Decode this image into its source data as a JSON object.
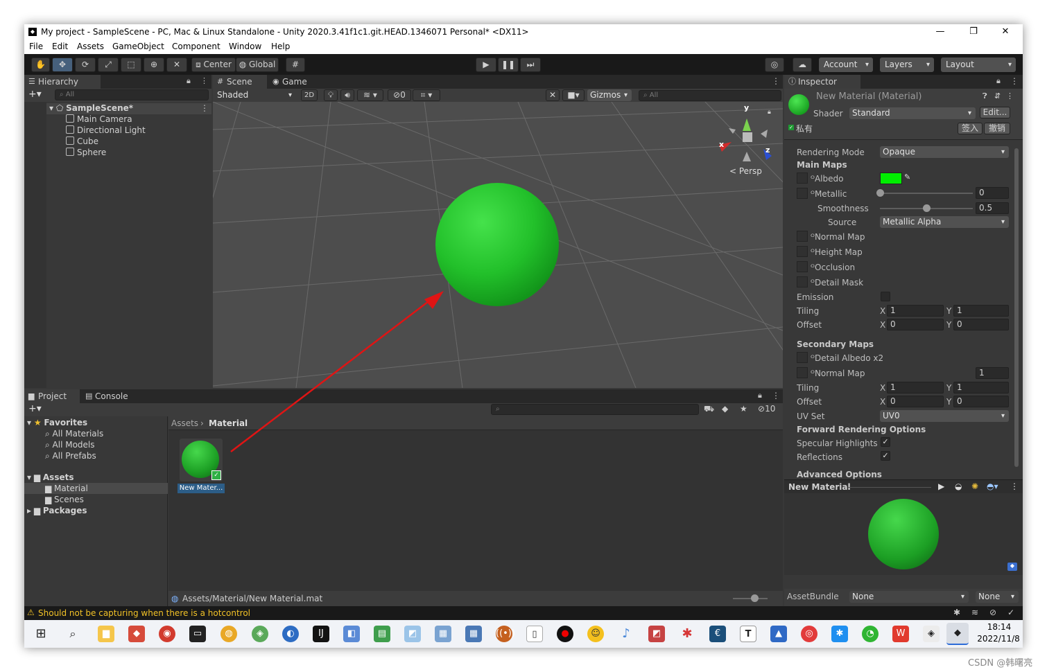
{
  "window": {
    "title": "My project - SampleScene - PC, Mac & Linux Standalone - Unity 2020.3.41f1c1.git.HEAD.1346071 Personal* <DX11>",
    "min": "—",
    "max": "❐",
    "close": "✕"
  },
  "menu": [
    "File",
    "Edit",
    "Assets",
    "GameObject",
    "Component",
    "Window",
    "Help"
  ],
  "toolbar": {
    "center": "Center",
    "global": "Global",
    "account": "Account",
    "layers": "Layers",
    "layout": "Layout"
  },
  "hierarchy": {
    "tab": "Hierarchy",
    "search": "All",
    "scene": "SampleScene*",
    "items": [
      "Main Camera",
      "Directional Light",
      "Cube",
      "Sphere"
    ]
  },
  "scene": {
    "tab_scene": "Scene",
    "tab_game": "Game",
    "shading": "Shaded",
    "mode2d": "2D",
    "hidden_count": "0",
    "gizmos": "Gizmos",
    "search": "All",
    "persp": "Persp",
    "axis_x": "x",
    "axis_y": "y",
    "axis_z": "z"
  },
  "project": {
    "tab_project": "Project",
    "tab_console": "Console",
    "favorites": "Favorites",
    "fav_items": [
      "All Materials",
      "All Models",
      "All Prefabs"
    ],
    "assets": "Assets",
    "asset_items": [
      "Material",
      "Scenes"
    ],
    "packages": "Packages",
    "breadcrumb_root": "Assets",
    "breadcrumb_current": "Material",
    "asset_label": "New Mater...",
    "path": "Assets/Material/New Material.mat",
    "count": "10"
  },
  "inspector": {
    "tab": "Inspector",
    "title": "New Material (Material)",
    "shader_label": "Shader",
    "shader_value": "Standard",
    "edit": "Edit...",
    "private": "私有",
    "signin": "签入",
    "undo": "撤销",
    "rendering_mode_label": "Rendering Mode",
    "rendering_mode": "Opaque",
    "main_maps": "Main Maps",
    "albedo": "Albedo",
    "albedo_color": "#00ee00",
    "metallic": "Metallic",
    "metallic_value": "0",
    "metallic_slider": 0,
    "smoothness": "Smoothness",
    "smoothness_value": "0.5",
    "smoothness_slider": 0.5,
    "source": "Source",
    "source_value": "Metallic Alpha",
    "normal_map": "Normal Map",
    "height_map": "Height Map",
    "occlusion": "Occlusion",
    "detail_mask": "Detail Mask",
    "emission": "Emission",
    "tiling": "Tiling",
    "offset": "Offset",
    "x": "X",
    "y": "Y",
    "tiling_x": "1",
    "tiling_y": "1",
    "offset_x": "0",
    "offset_y": "0",
    "secondary_maps": "Secondary Maps",
    "detail_albedo": "Detail Albedo x2",
    "normal_map2": "Normal Map",
    "normal_map2_value": "1",
    "tiling2_x": "1",
    "tiling2_y": "1",
    "offset2_x": "0",
    "offset2_y": "0",
    "uv_set": "UV Set",
    "uv_value": "UV0",
    "fwd_options": "Forward Rendering Options",
    "specular": "Specular Highlights",
    "reflections": "Reflections",
    "advanced": "Advanced Options",
    "preview_title": "New Material",
    "assetbundle": "AssetBundle",
    "bundle_value": "None",
    "variant_value": "None"
  },
  "status": {
    "warning": "Should not be capturing when there is a hotcontrol"
  },
  "taskbar": {
    "time": "18:14",
    "date": "2022/11/8"
  },
  "watermark": "CSDN @韩曙亮",
  "colors": {
    "sphere": "#22c02a",
    "arrow": "#e01414",
    "selection": "#2c5d87"
  }
}
